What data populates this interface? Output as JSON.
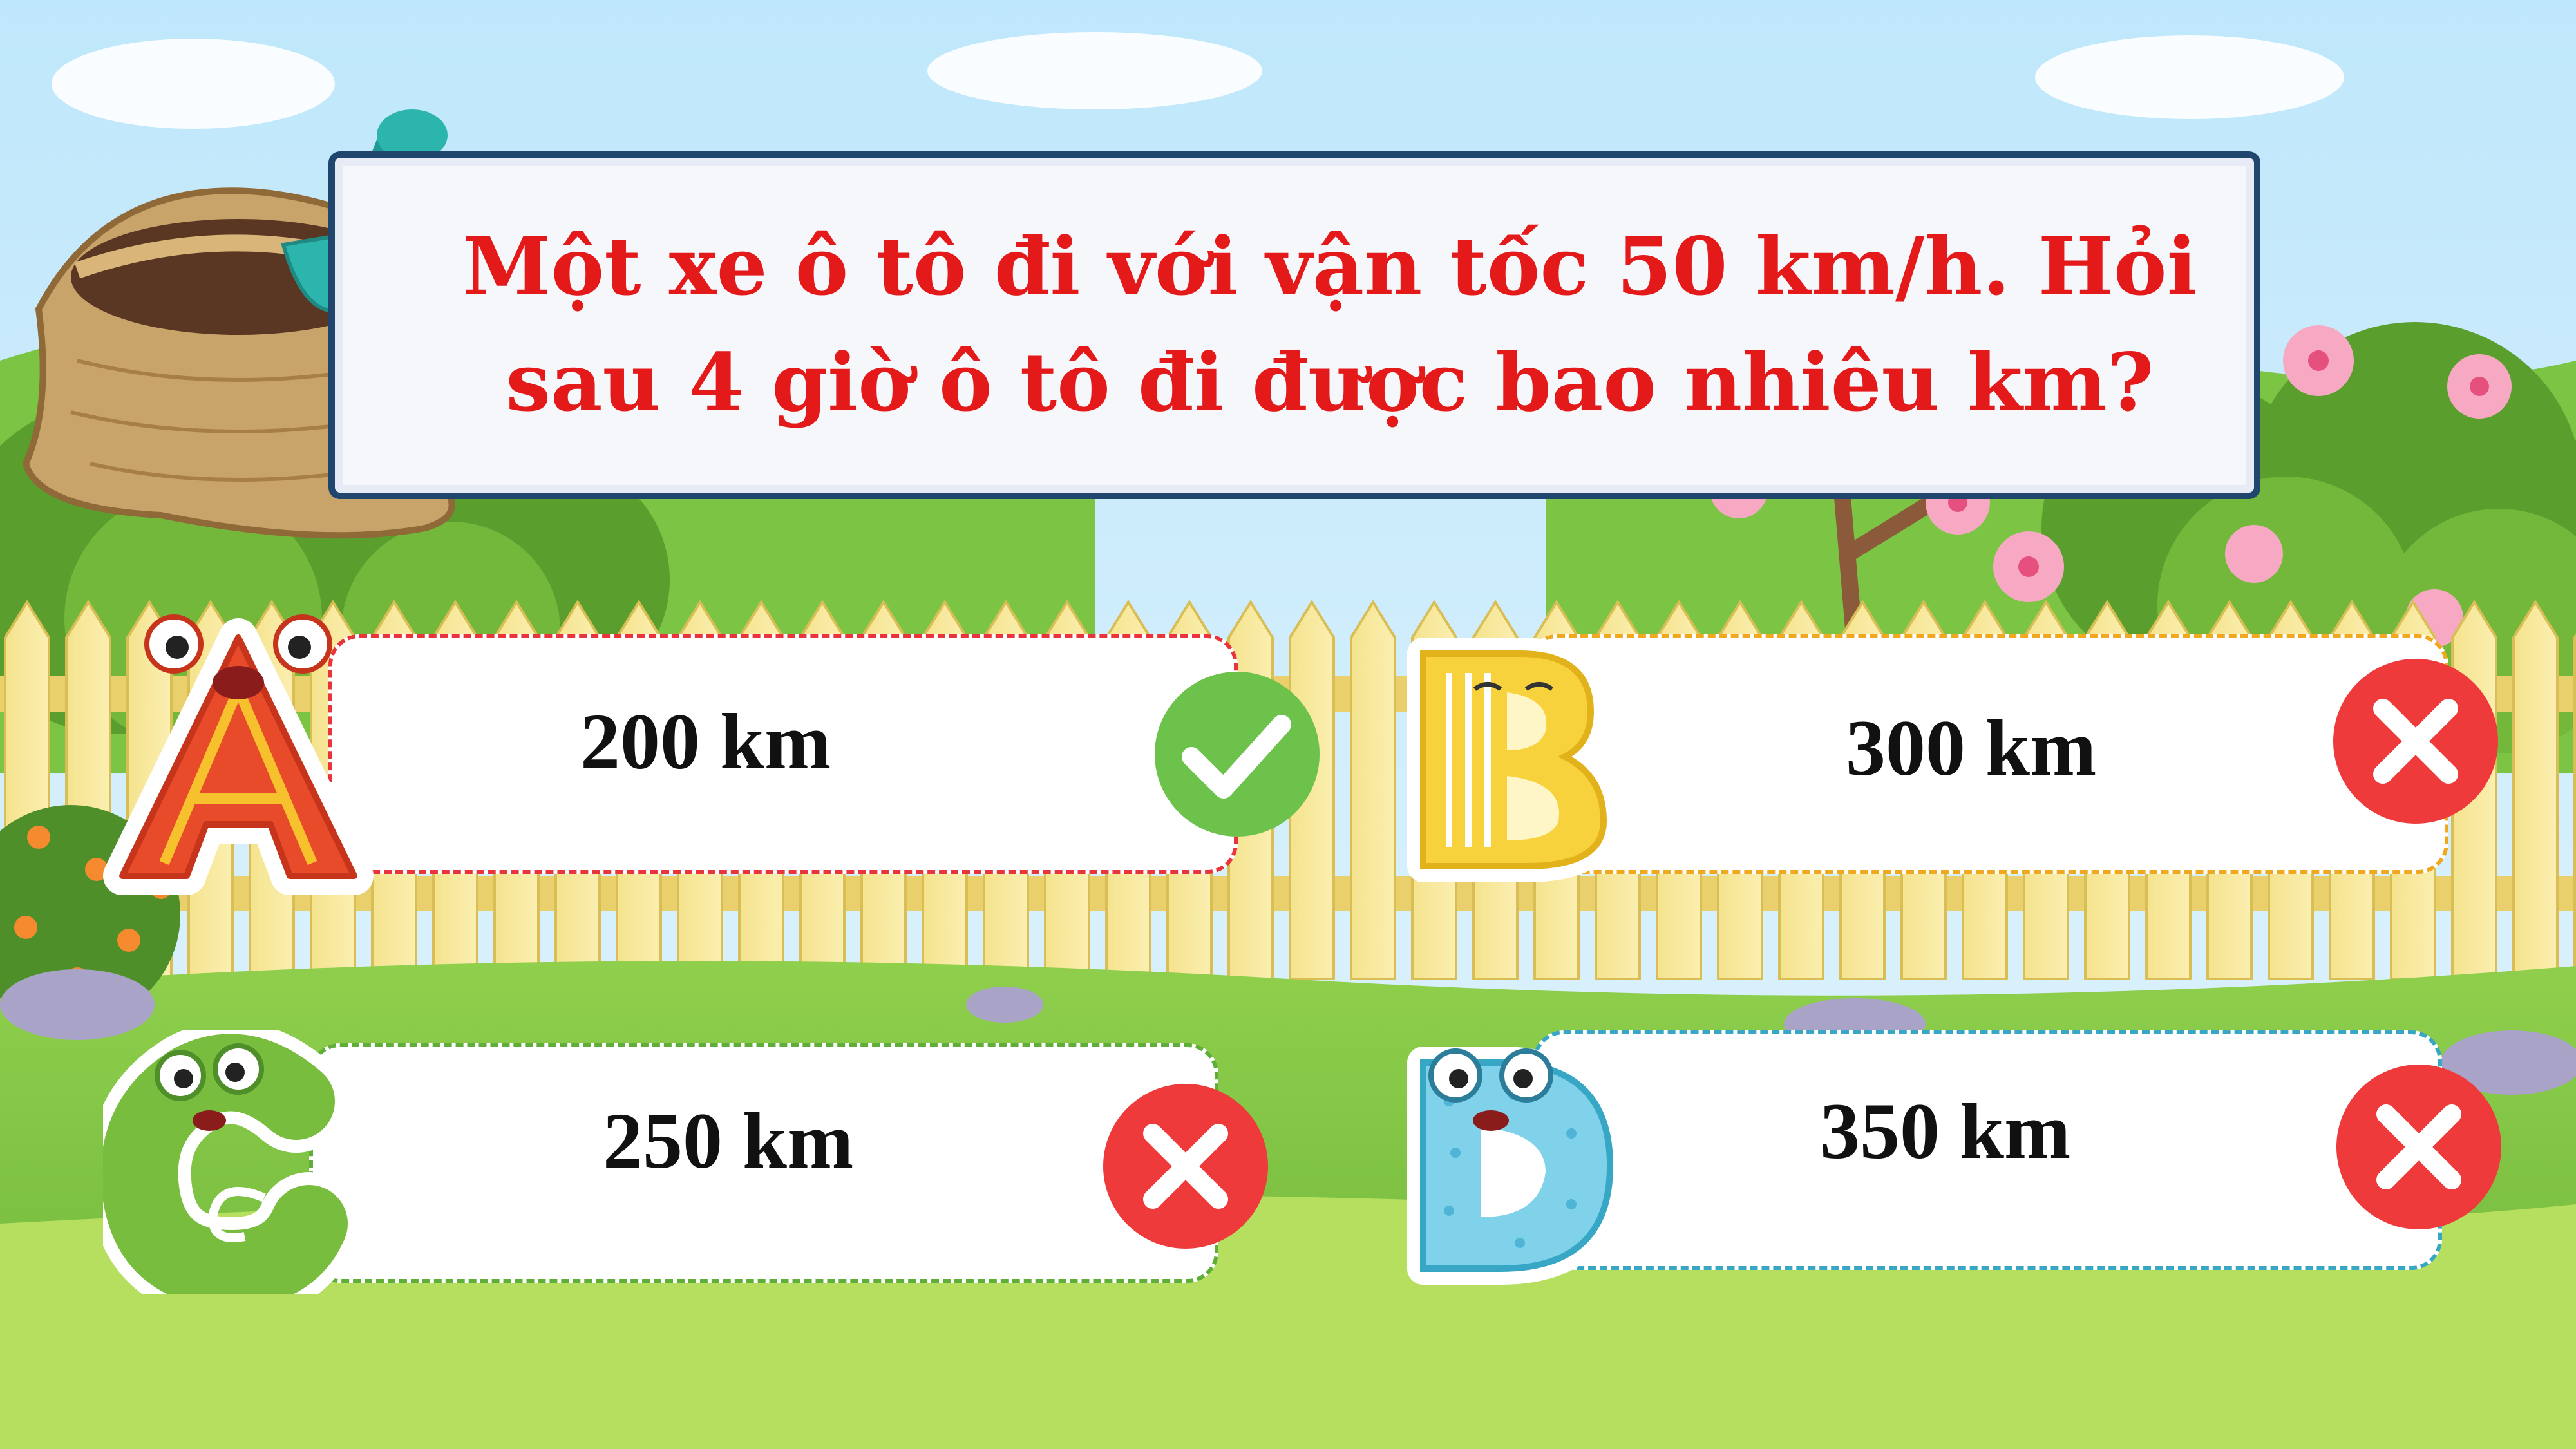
{
  "question": {
    "line1": "Một xe ô tô đi với vận tốc 50 km/h. Hỏi",
    "line2": "sau 4 giờ ô tô đi được bao nhiêu km?"
  },
  "answers": [
    {
      "letter": "A",
      "text": "200 km",
      "result": "correct",
      "accent": "#e8343a"
    },
    {
      "letter": "B",
      "text": "300 km",
      "result": "wrong",
      "accent": "#f0a81f"
    },
    {
      "letter": "C",
      "text": "250 km",
      "result": "wrong",
      "accent": "#5fae38"
    },
    {
      "letter": "D",
      "text": "350 km",
      "result": "wrong",
      "accent": "#38a7c6"
    }
  ],
  "icons": {
    "correct": "check-icon",
    "wrong": "close-icon",
    "decor": "soil-sack-with-shovel"
  },
  "colors": {
    "question_text": "#e41a1a",
    "banner_border": "#20466e",
    "check_green": "#6cc24a",
    "cross_red": "#ee3a3a"
  }
}
